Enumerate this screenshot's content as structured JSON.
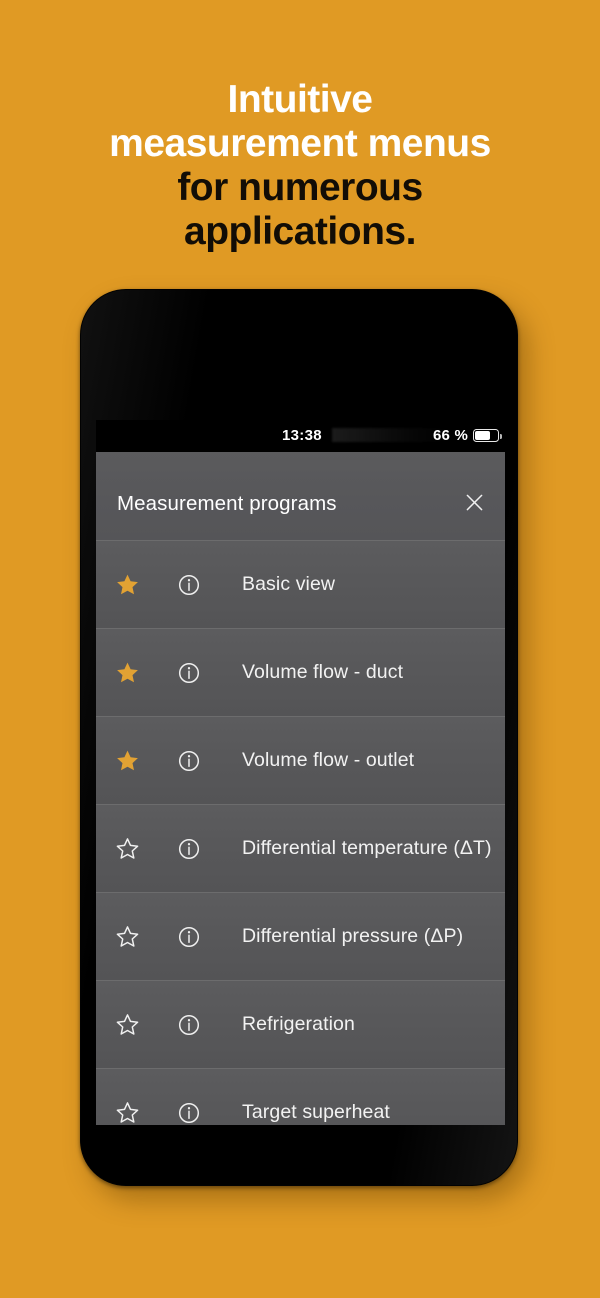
{
  "background_color": "#e09a24",
  "headline": {
    "lines": [
      {
        "text": "Intuitive",
        "color": "#ffffff"
      },
      {
        "text": "measurement menus",
        "color": "#ffffff"
      },
      {
        "text": "for numerous",
        "color": "#120d06"
      },
      {
        "text": "applications.",
        "color": "#120d06"
      }
    ]
  },
  "phone": {
    "status_bar": {
      "time": "13:38",
      "battery_percent_label": "66 %",
      "battery_level": 66
    },
    "dialog": {
      "title": "Measurement programs",
      "close_icon": "close-icon",
      "rows": [
        {
          "label": "Basic view",
          "favorite": true,
          "star_icon": "star-filled-icon",
          "info_icon": "info-icon"
        },
        {
          "label": "Volume flow - duct",
          "favorite": true,
          "star_icon": "star-filled-icon",
          "info_icon": "info-icon"
        },
        {
          "label": "Volume flow - outlet",
          "favorite": true,
          "star_icon": "star-filled-icon",
          "info_icon": "info-icon"
        },
        {
          "label": "Differential temperature (ΔT)",
          "favorite": false,
          "star_icon": "star-outline-icon",
          "info_icon": "info-icon"
        },
        {
          "label": "Differential pressure (ΔP)",
          "favorite": false,
          "star_icon": "star-outline-icon",
          "info_icon": "info-icon"
        },
        {
          "label": "Refrigeration",
          "favorite": false,
          "star_icon": "star-outline-icon",
          "info_icon": "info-icon"
        },
        {
          "label": "Target superheat",
          "favorite": false,
          "star_icon": "star-outline-icon",
          "info_icon": "info-icon"
        }
      ]
    }
  },
  "colors": {
    "accent_orange": "#e09a24",
    "star_orange": "#e2a233",
    "row_gray": "#58585a",
    "header_gray": "#57575a",
    "text_white": "#f2f2f2"
  }
}
